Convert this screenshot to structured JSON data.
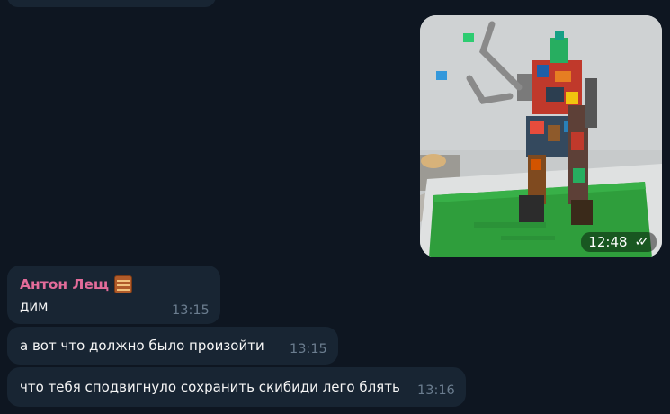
{
  "photo_message": {
    "time": "12:48",
    "status_icon": "double-check-read-icon"
  },
  "messages": [
    {
      "sender": "Антон Лещ",
      "sender_badge_icon": "abacus-emoji-icon",
      "text": "дим",
      "time": "13:15"
    },
    {
      "text": "а вот что должно было произойти",
      "time": "13:15"
    },
    {
      "text": "что тебя сподвигнуло сохранить скибиди лего блять",
      "time": "13:16"
    }
  ],
  "colors": {
    "background": "#0e1621",
    "incoming_bubble": "#182533",
    "sender_name": "#e36c9a",
    "timestamp": "#6b7d8f",
    "text": "#f5f5f5"
  }
}
